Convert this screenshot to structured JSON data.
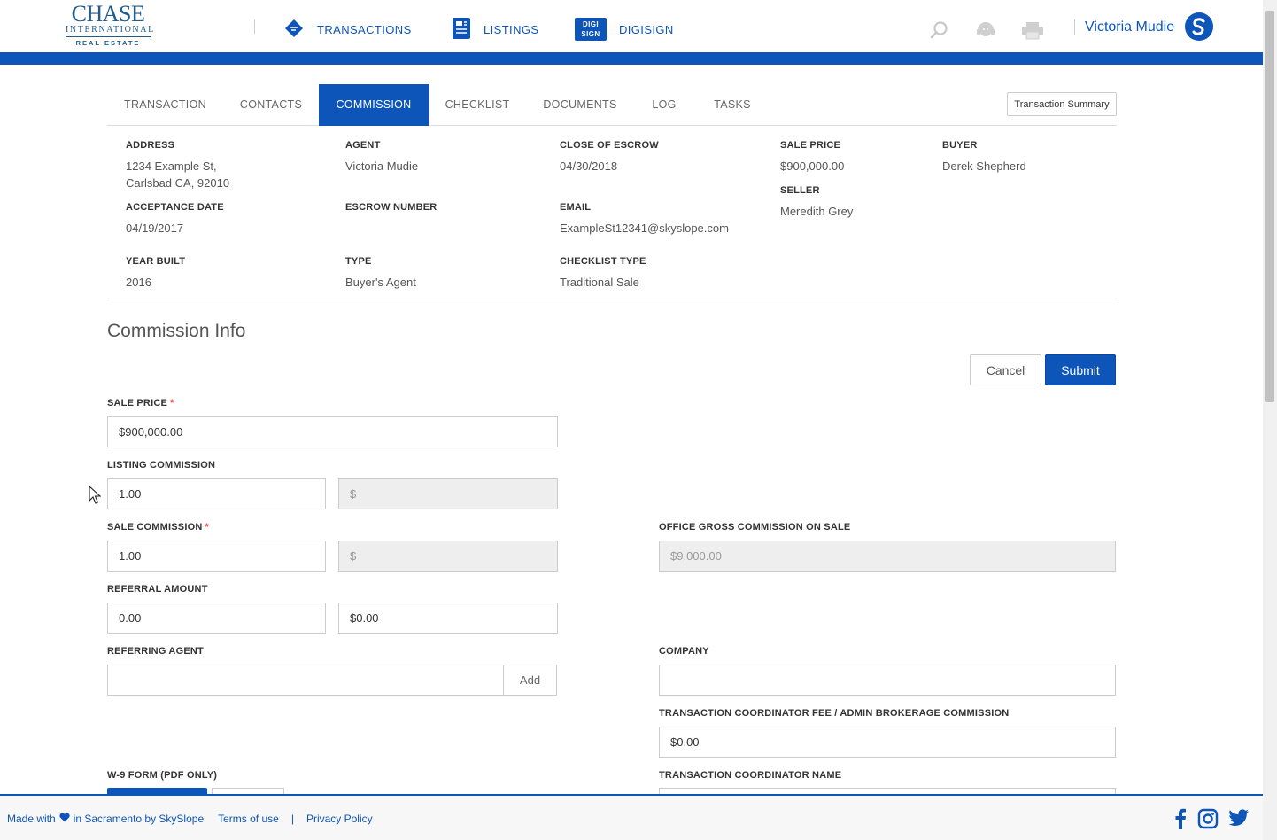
{
  "header": {
    "logo_main": "CHASE",
    "logo_sub": "INTERNATIONAL",
    "logo_sub2": "REAL ESTATE",
    "nav": [
      {
        "label": "TRANSACTIONS",
        "icon": "tag-icon"
      },
      {
        "label": "LISTINGS",
        "icon": "document-list-icon"
      },
      {
        "label": "DIGISIGN",
        "icon": "digisign-icon"
      }
    ],
    "digisign_icon_text_1": "DIGI",
    "digisign_icon_text_2": "SIGN",
    "user_name": "Victoria Mudie",
    "avatar_letter": "S"
  },
  "tabs": [
    {
      "label": "TRANSACTION",
      "active": false
    },
    {
      "label": "CONTACTS",
      "active": false
    },
    {
      "label": "COMMISSION",
      "active": true
    },
    {
      "label": "CHECKLIST",
      "active": false
    },
    {
      "label": "DOCUMENTS",
      "active": false
    },
    {
      "label": "LOG",
      "active": false
    },
    {
      "label": "TASKS",
      "active": false
    }
  ],
  "transaction_summary_label": "Transaction Summary",
  "summary": {
    "address_label": "ADDRESS",
    "address_line1": "1234 Example St,",
    "address_line2": "Carlsbad CA, 92010",
    "agent_label": "AGENT",
    "agent": "Victoria Mudie",
    "close_label": "CLOSE OF ESCROW",
    "close": "04/30/2018",
    "sale_price_label": "SALE PRICE",
    "sale_price": "$900,000.00",
    "buyer_label": "BUYER",
    "buyer": "Derek Shepherd",
    "seller_label": "SELLER",
    "seller": "Meredith Grey",
    "acceptance_label": "ACCEPTANCE DATE",
    "acceptance": "04/19/2017",
    "escrow_label": "ESCROW NUMBER",
    "escrow": "",
    "email_label": "EMAIL",
    "email": "ExampleSt12341@skyslope.com",
    "year_label": "YEAR BUILT",
    "year": "2016",
    "type_label": "TYPE",
    "type": "Buyer's Agent",
    "checklist_type_label": "CHECKLIST TYPE",
    "checklist_type": "Traditional Sale"
  },
  "commission": {
    "title": "Commission Info",
    "cancel_label": "Cancel",
    "submit_label": "Submit",
    "sale_price_label": "SALE PRICE",
    "sale_price_value": "$900,000.00",
    "listing_commission_label": "LISTING COMMISSION",
    "listing_commission_pct": "1.00",
    "listing_commission_amount": "",
    "listing_commission_amount_placeholder": "$",
    "sale_commission_label": "SALE COMMISSION",
    "sale_commission_pct": "1.00",
    "sale_commission_amount": "",
    "sale_commission_amount_placeholder": "$",
    "office_gross_label": "OFFICE GROSS COMMISSION ON SALE",
    "office_gross_value": "$9,000.00",
    "referral_label": "REFERRAL AMOUNT",
    "referral_pct": "0.00",
    "referral_amount": "$0.00",
    "referring_agent_label": "REFERRING AGENT",
    "referring_agent_value": "",
    "add_label": "Add",
    "company_label": "COMPANY",
    "company_value": "",
    "tc_fee_label": "TRANSACTION COORDINATOR FEE / ADMIN BROKERAGE COMMISSION",
    "tc_fee_value": "$0.00",
    "w9_label": "W-9 FORM (PDF ONLY)",
    "tc_name_label": "TRANSACTION COORDINATOR NAME",
    "required_mark": "*"
  },
  "footer": {
    "made_with": "Made with",
    "made_in": "in Sacramento by SkySlope",
    "terms": "Terms of use",
    "separator": "|",
    "privacy": "Privacy Policy"
  },
  "colors": {
    "brand_blue": "#0d55b8",
    "required_red": "#e0403b"
  }
}
